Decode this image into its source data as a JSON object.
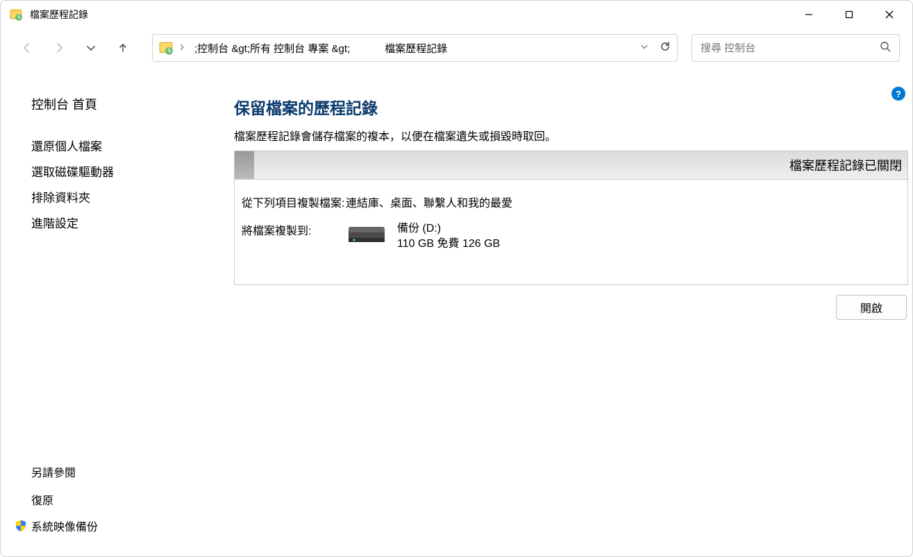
{
  "window": {
    "title": "檔案歷程記錄"
  },
  "address": {
    "breadcrumb": ";控制台 &gt;所有 控制台 專案 &gt;",
    "current": "檔案歷程記錄"
  },
  "search": {
    "placeholder": "搜尋 控制台"
  },
  "sidebar": {
    "home": "控制台 首頁",
    "links": [
      "還原個人檔案",
      "選取磁碟驅動器",
      "排除資料夾",
      "進階設定"
    ],
    "see_also_heading": "另請參閱",
    "footer_links": [
      "復原",
      "系統映像備份"
    ]
  },
  "main": {
    "heading": "保留檔案的歷程記錄",
    "description": "檔案歷程記錄會儲存檔案的複本，以便在檔案遺失或損毀時取回。",
    "status": "檔案歷程記錄已關閉",
    "copy_from_label": "從下列項目複製檔案:",
    "copy_from_value": "連結庫、桌面、聯繫人和我的最愛",
    "copy_to_label": "將檔案複製到:",
    "drive_name": "備份 (D:)",
    "drive_space": "110 GB 免費 126    GB",
    "turn_on": "開啟"
  }
}
